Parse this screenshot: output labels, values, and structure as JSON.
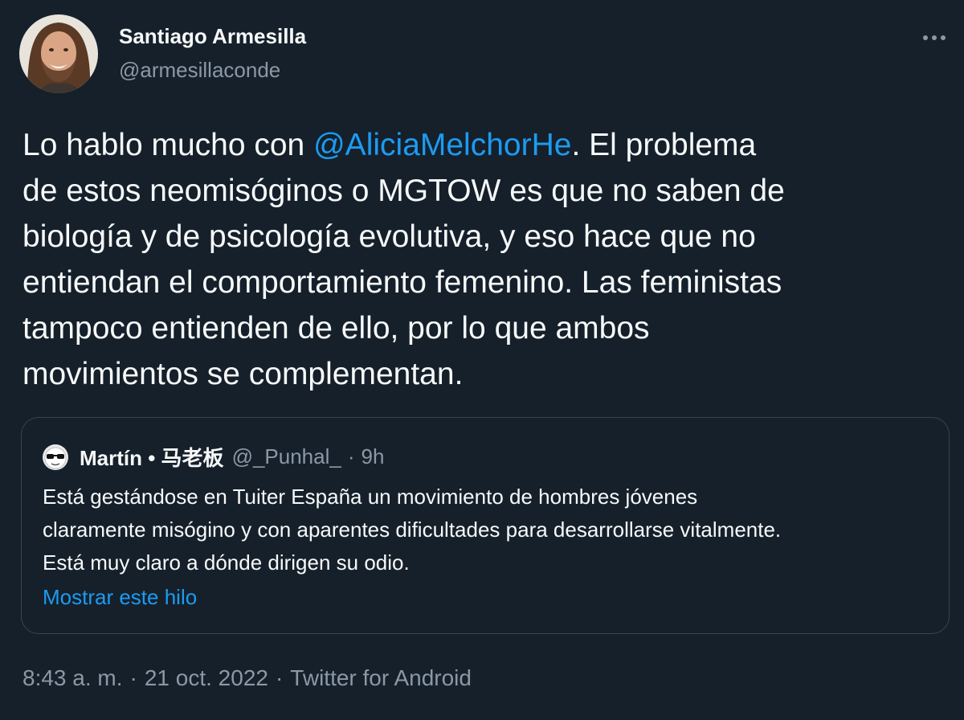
{
  "author": {
    "display_name": "Santiago Armesilla",
    "handle": "@armesillaconde",
    "avatar_icon": "profile-photo"
  },
  "more_icon": "more-horizontal-icon",
  "tweet": {
    "line1_before": "Lo hablo mucho con ",
    "mention": "@AliciaMelchorHe",
    "line1_after": ". El problema",
    "line2": "de estos neomisóginos o MGTOW es que no saben de",
    "line3": "biología y de psicología evolutiva, y eso hace que no",
    "line4": "entiendan el comportamiento femenino. Las feministas",
    "line5": "tampoco entienden de ello, por lo que ambos",
    "line6": "movimientos se complementan."
  },
  "quoted": {
    "display_name": "Martín • 马老板",
    "handle": "@_Punhal_",
    "separator": "·",
    "time": "9h",
    "avatar_icon": "sunglasses-avatar-icon",
    "line1": "Está gestándose en Tuiter España un movimiento de hombres jóvenes",
    "line2": "claramente misógino y con aparentes dificultades para desarrollarse vitalmente.",
    "line3": "Está muy claro a dónde dirigen su odio.",
    "show_thread": "Mostrar este hilo"
  },
  "meta": {
    "time": "8:43 a. m.",
    "date": "21 oct. 2022",
    "source": "Twitter for Android",
    "separator": "·"
  },
  "colors": {
    "background": "#15202b",
    "text": "#f7f9f9",
    "secondary": "#8b98a5",
    "accent": "#1d9bf0",
    "border": "#38444d"
  }
}
